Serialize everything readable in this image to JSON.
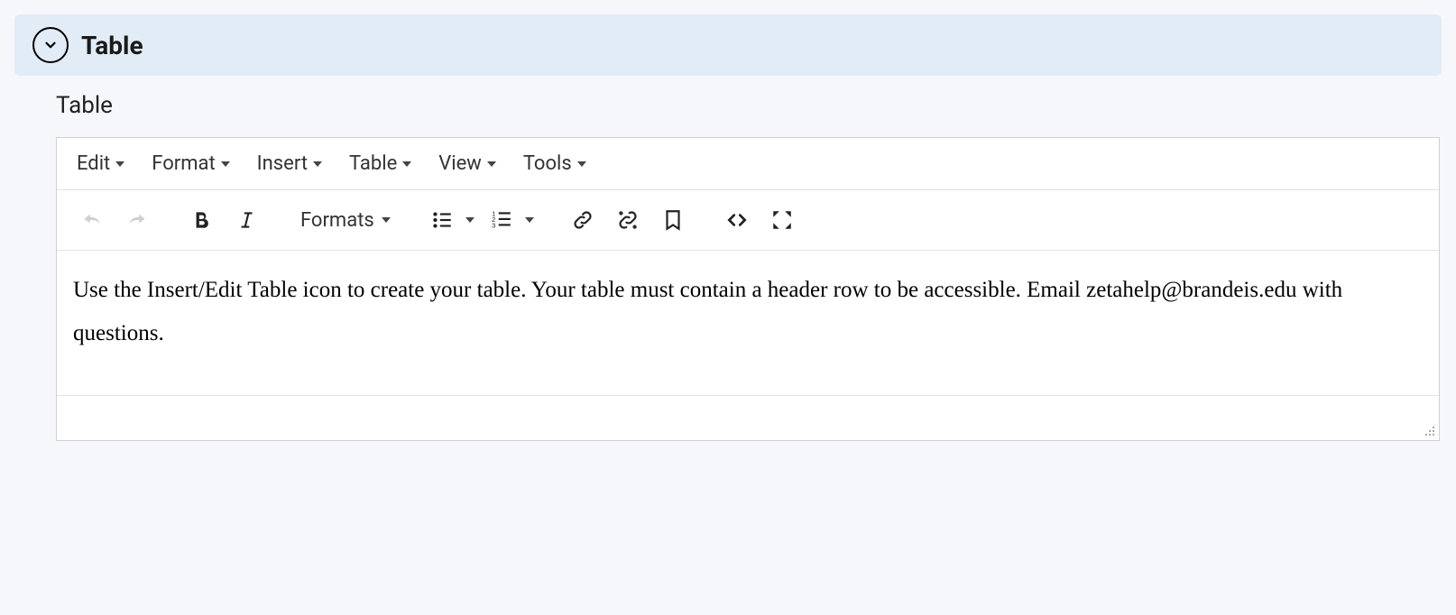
{
  "header": {
    "title": "Table"
  },
  "field": {
    "label": "Table"
  },
  "menubar": {
    "items": [
      {
        "label": "Edit"
      },
      {
        "label": "Format"
      },
      {
        "label": "Insert"
      },
      {
        "label": "Table"
      },
      {
        "label": "View"
      },
      {
        "label": "Tools"
      }
    ]
  },
  "toolbar": {
    "formats_label": "Formats"
  },
  "content": {
    "text": "Use the Insert/Edit Table icon to create your table. Your table must contain a header row to be accessible. Email zetahelp@brandeis.edu with questions."
  }
}
